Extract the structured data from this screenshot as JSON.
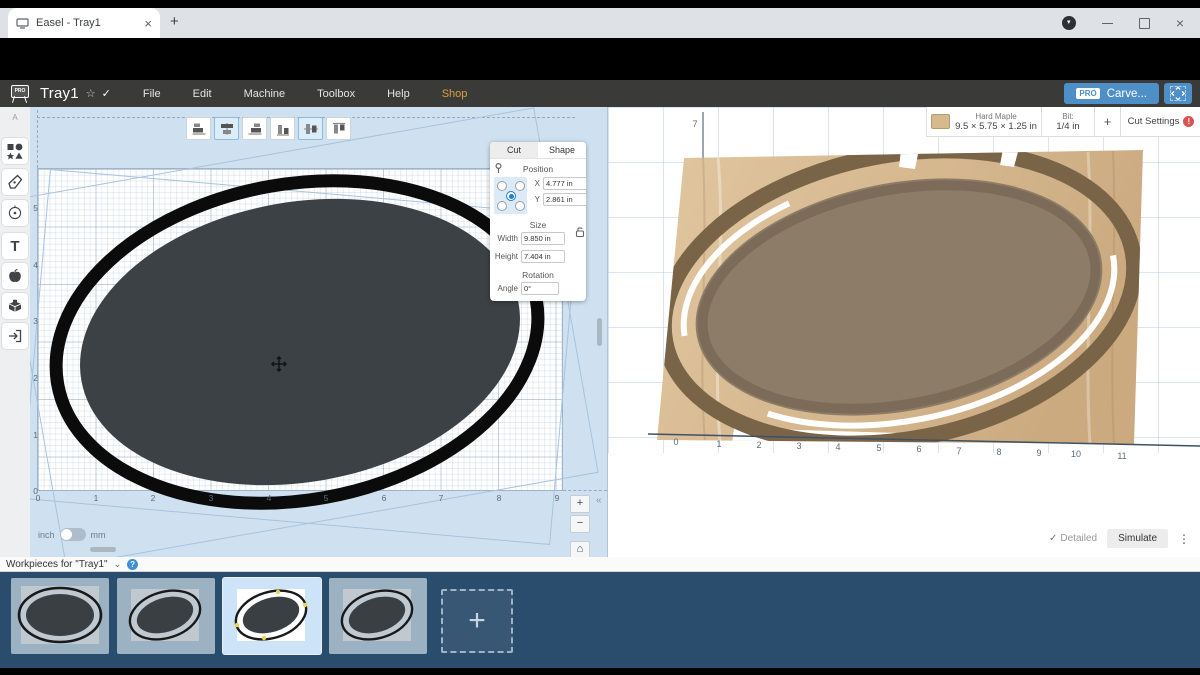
{
  "browser": {
    "tab_title": "Easel - Tray1",
    "close_glyph": "×",
    "new_tab_glyph": "+",
    "menu_arrow_glyph": "▾"
  },
  "menubar": {
    "logo_badge": "PRO",
    "project_title": "Tray1",
    "star_glyph": "☆",
    "check_glyph": "✓",
    "menus": [
      "File",
      "Edit",
      "Machine",
      "Toolbox",
      "Help",
      "Shop"
    ],
    "carve": {
      "badge": "PRO",
      "label": "Carve..."
    }
  },
  "sidebar": {
    "top_glyph": "A",
    "text_tool_glyph": "T"
  },
  "canvas2d": {
    "ruler_x": [
      "0",
      "1",
      "2",
      "3",
      "4",
      "5",
      "6",
      "7",
      "8",
      "9"
    ],
    "ruler_y": [
      "5",
      "4",
      "3",
      "2",
      "1",
      "0"
    ],
    "units": {
      "left": "inch",
      "right": "mm",
      "selected": "inch"
    },
    "zoom": {
      "in": "+",
      "out": "−",
      "home": "⌂"
    },
    "collapse_glyph": "«",
    "shape_panel": {
      "tabs": [
        "Cut",
        "Shape"
      ],
      "active_tab": "Shape",
      "position_label": "Position",
      "x_label": "X",
      "x_value": "4.777 in",
      "y_label": "Y",
      "y_value": "2.861 in",
      "size_label": "Size",
      "width_label": "Width",
      "width_value": "9.850 in",
      "height_label": "Height",
      "height_value": "7.404 in",
      "rotation_label": "Rotation",
      "angle_label": "Angle",
      "angle_value": "0°"
    }
  },
  "preview3d": {
    "material": {
      "name": "Hard Maple",
      "dimensions": "9.5 × 5.75 × 1.25 in",
      "color": "#d7b98e"
    },
    "bit": {
      "label": "Bit:",
      "value": "1/4 in"
    },
    "add_bit_glyph": "+",
    "cut_settings_label": "Cut Settings",
    "alert_glyph": "!",
    "axis_x": [
      "0",
      "1",
      "2",
      "3",
      "4",
      "5",
      "6",
      "7",
      "8",
      "9",
      "10",
      "11"
    ],
    "axis_y_label": "7",
    "detailed_check": "✓",
    "detailed_label": "Detailed",
    "simulate_label": "Simulate",
    "menu_dots": "⋮"
  },
  "workpieces": {
    "header": "Workpieces for \"Tray1\"",
    "chevron_glyph": "⌄",
    "help_glyph": "?",
    "add_glyph": "+"
  },
  "colors": {
    "carve_blue": "#4d8fc6",
    "shop_orange": "#dd9e3e",
    "canvas_blue": "#cfe1f0",
    "workpiece_strip": "#2b4d6d",
    "selected_card": "#cde3f7",
    "wood": "#d7b98e",
    "alert_red": "#d9534f"
  }
}
